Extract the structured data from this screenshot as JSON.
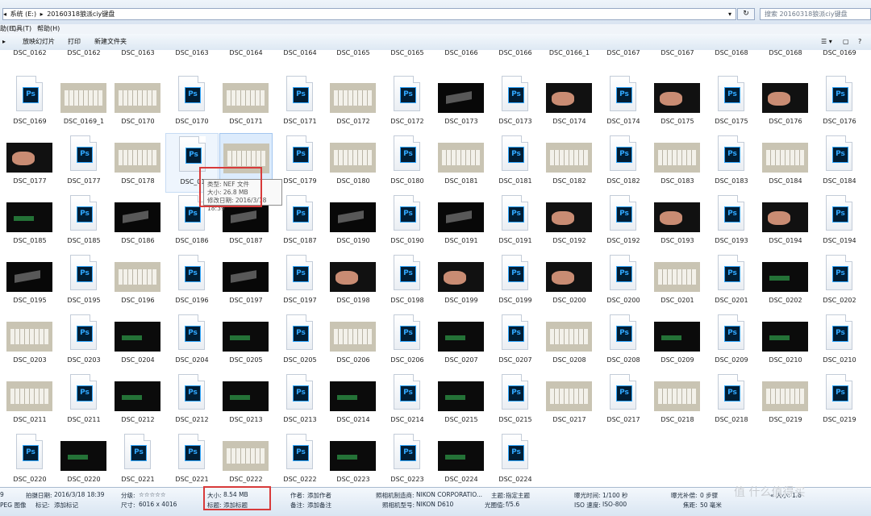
{
  "address": {
    "crumbs": [
      "◂",
      "系统 (E:)",
      "▸",
      "20160318狼派ciy键盘",
      "▾"
    ],
    "refresh": "↻",
    "search_placeholder": "搜索 20160318狼派ciy键盘"
  },
  "menu": {
    "items": [
      "助(H)",
      "工具(T)",
      "帮助(H)"
    ]
  },
  "toolbar": {
    "arrow": "▸",
    "items": [
      "放映幻灯片",
      "打印",
      "新建文件夹"
    ],
    "view_icons": [
      "☰ ▾",
      "▢",
      "?"
    ]
  },
  "tooltip": {
    "line1": "类型: NEF 文件",
    "line2": "大小: 26.8 MB",
    "line3": "修改日期: 2016/3/18 18:39"
  },
  "details": {
    "type_short": "9",
    "type_name": "PEG 图像",
    "shot_date_label": "拍摄日期:",
    "shot_date": "2016/3/18 18:39",
    "tags_label": "标记:",
    "tags": "添加标记",
    "rating_label": "分级:",
    "rating_stars": "☆☆☆☆☆",
    "dims_label": "尺寸:",
    "dims": "6016 x 4016",
    "size_label": "大小:",
    "size": "8.54 MB",
    "title_label": "标题:",
    "title": "添加标题",
    "author_label": "作者:",
    "author": "添加作者",
    "comments_label": "备注:",
    "comments": "添加备注",
    "maker_label": "照相机制造商:",
    "maker": "NIKON CORPORATIO...",
    "model_label": "照相机型号:",
    "model": "NIKON D610",
    "subject_label": "主题:",
    "subject": "指定主题",
    "fstop_label": "光圈值:",
    "fstop": "f/5.6",
    "exposure_label": "曝光时间:",
    "exposure": "1/100 秒",
    "iso_label": "ISO 速度:",
    "iso": "ISO-800",
    "bias_label": "曝光补偿:",
    "bias": "0 步骤",
    "focal_label": "焦距:",
    "focal": "50 毫米",
    "more": "« 大小: 1.6"
  },
  "watermark": "值 什么值得买",
  "rows": [
    [
      [
        "x",
        "DSC_0162"
      ],
      [
        "x",
        "DSC_0162"
      ],
      [
        "x",
        "DSC_0163"
      ],
      [
        "x",
        "DSC_0163"
      ],
      [
        "x",
        "DSC_0164"
      ],
      [
        "x",
        "DSC_0164"
      ],
      [
        "x",
        "DSC_0165"
      ],
      [
        "x",
        "DSC_0165"
      ],
      [
        "x",
        "DSC_0166"
      ],
      [
        "x",
        "DSC_0166"
      ],
      [
        "x",
        "DSC_0166_1"
      ],
      [
        "x",
        "DSC_0167"
      ],
      [
        "x",
        "DSC_0167"
      ],
      [
        "x",
        "DSC_0168"
      ],
      [
        "x",
        "DSC_0168"
      ],
      [
        "x",
        "DSC_0169"
      ]
    ],
    [
      [
        "p",
        "DSC_0169"
      ],
      [
        "l",
        "DSC_0169_1"
      ],
      [
        "l",
        "DSC_0170"
      ],
      [
        "p",
        "DSC_0170"
      ],
      [
        "l",
        "DSC_0171"
      ],
      [
        "p",
        "DSC_0171"
      ],
      [
        "l",
        "DSC_0172"
      ],
      [
        "p",
        "DSC_0172"
      ],
      [
        "d",
        "DSC_0173"
      ],
      [
        "p",
        "DSC_0173"
      ],
      [
        "h",
        "DSC_0174"
      ],
      [
        "p",
        "DSC_0174"
      ],
      [
        "h",
        "DSC_0175"
      ],
      [
        "p",
        "DSC_0175"
      ],
      [
        "h",
        "DSC_0176"
      ],
      [
        "p",
        "DSC_0176"
      ]
    ],
    [
      [
        "h",
        "DSC_0177"
      ],
      [
        "p",
        "DSC_0177"
      ],
      [
        "l",
        "DSC_0178"
      ],
      [
        "p",
        "DSC_01"
      ],
      [
        "l",
        "DSC_0178"
      ],
      [
        "p",
        "DSC_0179"
      ],
      [
        "l",
        "DSC_0180"
      ],
      [
        "p",
        "DSC_0180"
      ],
      [
        "l",
        "DSC_0181"
      ],
      [
        "p",
        "DSC_0181"
      ],
      [
        "l",
        "DSC_0182"
      ],
      [
        "p",
        "DSC_0182"
      ],
      [
        "l",
        "DSC_0183"
      ],
      [
        "p",
        "DSC_0183"
      ],
      [
        "l",
        "DSC_0184"
      ],
      [
        "p",
        "DSC_0184"
      ]
    ],
    [
      [
        "g",
        "DSC_0185"
      ],
      [
        "p",
        "DSC_0185"
      ],
      [
        "d",
        "DSC_0186"
      ],
      [
        "p",
        "DSC_0186"
      ],
      [
        "d",
        "DSC_0187"
      ],
      [
        "p",
        "DSC_0187"
      ],
      [
        "d",
        "DSC_0190"
      ],
      [
        "p",
        "DSC_0190"
      ],
      [
        "d",
        "DSC_0191"
      ],
      [
        "p",
        "DSC_0191"
      ],
      [
        "h",
        "DSC_0192"
      ],
      [
        "p",
        "DSC_0192"
      ],
      [
        "h",
        "DSC_0193"
      ],
      [
        "p",
        "DSC_0193"
      ],
      [
        "h",
        "DSC_0194"
      ],
      [
        "p",
        "DSC_0194"
      ]
    ],
    [
      [
        "d",
        "DSC_0195"
      ],
      [
        "p",
        "DSC_0195"
      ],
      [
        "l",
        "DSC_0196"
      ],
      [
        "p",
        "DSC_0196"
      ],
      [
        "d",
        "DSC_0197"
      ],
      [
        "p",
        "DSC_0197"
      ],
      [
        "h",
        "DSC_0198"
      ],
      [
        "p",
        "DSC_0198"
      ],
      [
        "h",
        "DSC_0199"
      ],
      [
        "p",
        "DSC_0199"
      ],
      [
        "h",
        "DSC_0200"
      ],
      [
        "p",
        "DSC_0200"
      ],
      [
        "l",
        "DSC_0201"
      ],
      [
        "p",
        "DSC_0201"
      ],
      [
        "g",
        "DSC_0202"
      ],
      [
        "p",
        "DSC_0202"
      ]
    ],
    [
      [
        "l",
        "DSC_0203"
      ],
      [
        "p",
        "DSC_0203"
      ],
      [
        "g",
        "DSC_0204"
      ],
      [
        "p",
        "DSC_0204"
      ],
      [
        "g",
        "DSC_0205"
      ],
      [
        "p",
        "DSC_0205"
      ],
      [
        "l",
        "DSC_0206"
      ],
      [
        "p",
        "DSC_0206"
      ],
      [
        "g",
        "DSC_0207"
      ],
      [
        "p",
        "DSC_0207"
      ],
      [
        "l",
        "DSC_0208"
      ],
      [
        "p",
        "DSC_0208"
      ],
      [
        "g",
        "DSC_0209"
      ],
      [
        "p",
        "DSC_0209"
      ],
      [
        "g",
        "DSC_0210"
      ],
      [
        "p",
        "DSC_0210"
      ]
    ],
    [
      [
        "l",
        "DSC_0211"
      ],
      [
        "p",
        "DSC_0211"
      ],
      [
        "g",
        "DSC_0212"
      ],
      [
        "p",
        "DSC_0212"
      ],
      [
        "g",
        "DSC_0213"
      ],
      [
        "p",
        "DSC_0213"
      ],
      [
        "g",
        "DSC_0214"
      ],
      [
        "p",
        "DSC_0214"
      ],
      [
        "g",
        "DSC_0215"
      ],
      [
        "p",
        "DSC_0215"
      ],
      [
        "l",
        "DSC_0217"
      ],
      [
        "p",
        "DSC_0217"
      ],
      [
        "l",
        "DSC_0218"
      ],
      [
        "p",
        "DSC_0218"
      ],
      [
        "l",
        "DSC_0219"
      ],
      [
        "p",
        "DSC_0219"
      ]
    ],
    [
      [
        "p",
        "DSC_0220"
      ],
      [
        "g",
        "DSC_0220"
      ],
      [
        "p",
        "DSC_0221"
      ],
      [
        "p",
        "DSC_0221"
      ],
      [
        "l",
        "DSC_0222"
      ],
      [
        "p",
        "DSC_0222"
      ],
      [
        "g",
        "DSC_0223"
      ],
      [
        "p",
        "DSC_0223"
      ],
      [
        "g",
        "DSC_0224"
      ],
      [
        "p",
        "DSC_0224"
      ]
    ]
  ]
}
